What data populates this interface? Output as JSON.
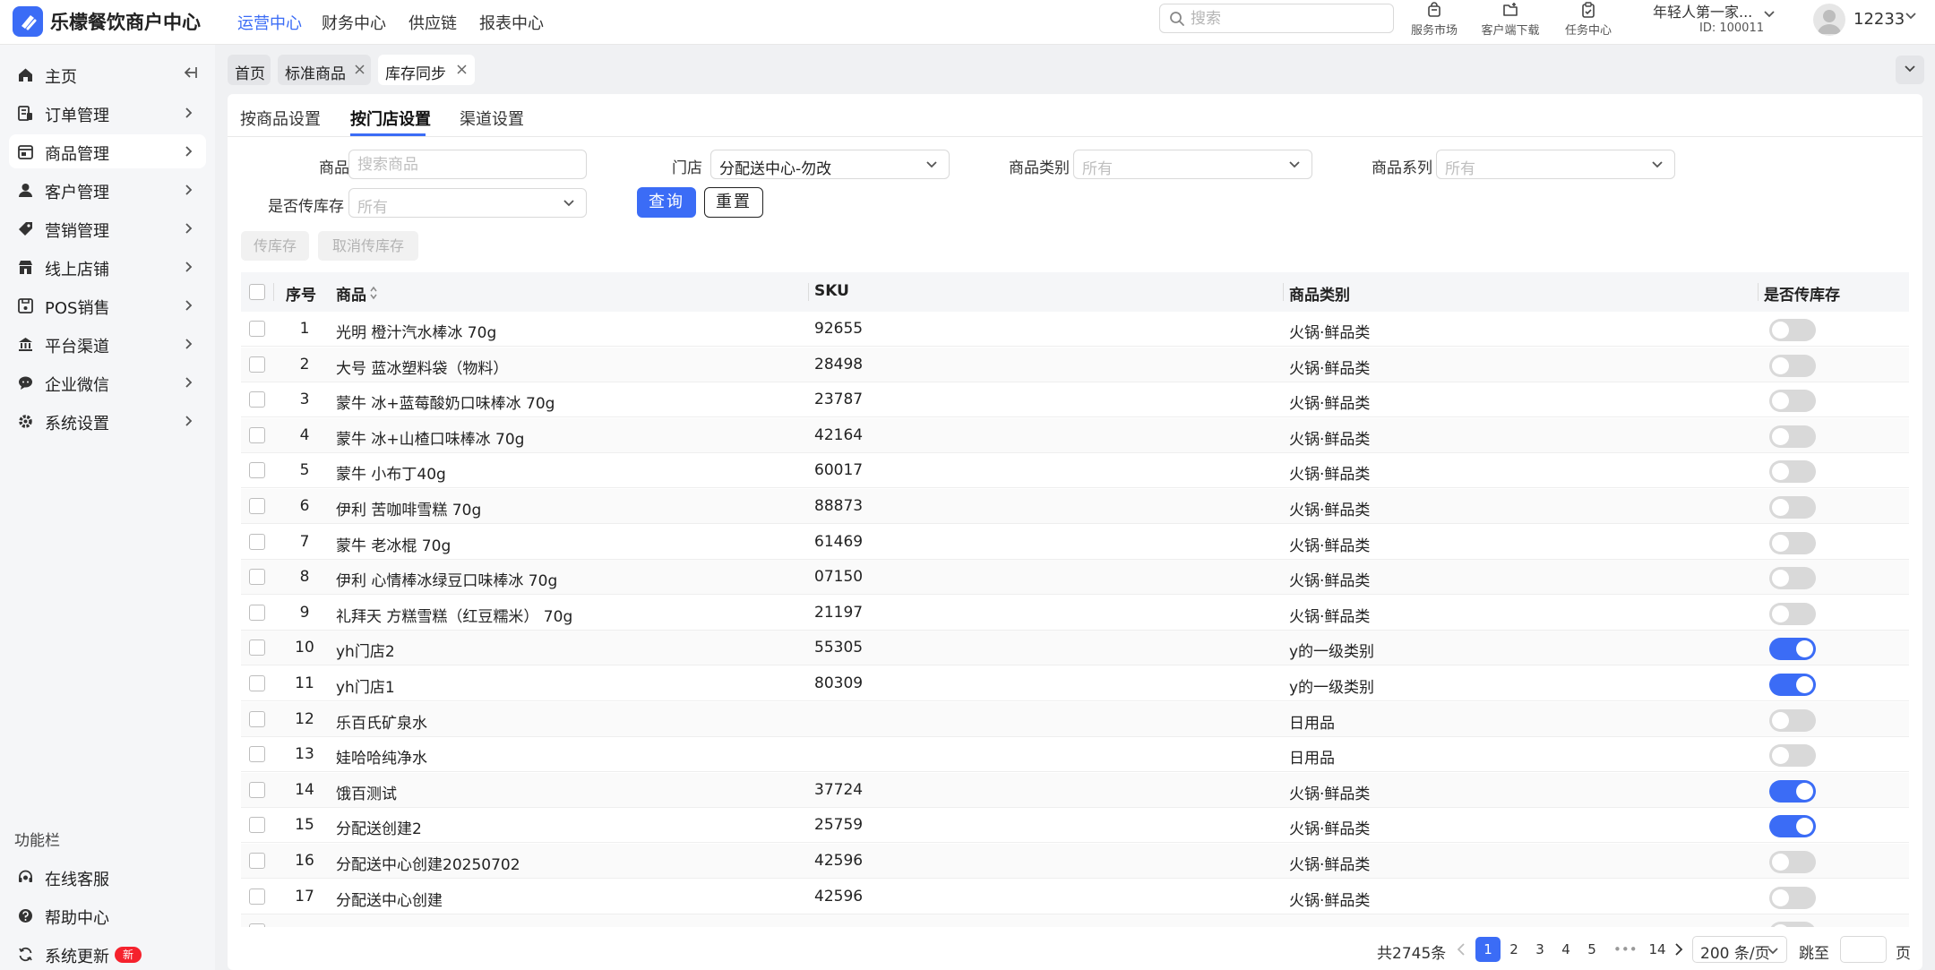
{
  "app": {
    "title": "乐檬餐饮商户中心"
  },
  "topnav": [
    "运营中心",
    "财务中心",
    "供应链",
    "报表中心"
  ],
  "search": {
    "placeholder": "搜索"
  },
  "tools": [
    "服务市场",
    "客户端下载",
    "任务中心"
  ],
  "account": {
    "name": "年轻人第一家...",
    "id": "ID: 100011",
    "user": "12233"
  },
  "sidebar": {
    "items": [
      "主页",
      "订单管理",
      "商品管理",
      "客户管理",
      "营销管理",
      "线上店铺",
      "POS销售",
      "平台渠道",
      "企业微信",
      "系统设置"
    ],
    "footer_title": "功能栏",
    "footer": [
      "在线客服",
      "帮助中心",
      "系统更新"
    ],
    "new_badge": "新"
  },
  "page_tabs": [
    "首页",
    "标准商品",
    "库存同步"
  ],
  "subtabs": [
    "按商品设置",
    "按门店设置",
    "渠道设置"
  ],
  "filters": {
    "product_label": "商品",
    "product_placeholder": "搜索商品",
    "store_label": "门店",
    "store_value": "分配送中心-勿改",
    "category_label": "商品类别",
    "category_value": "所有",
    "series_label": "商品系列",
    "series_value": "所有",
    "sync_label": "是否传库存",
    "sync_value": "所有"
  },
  "buttons": {
    "query": "查询",
    "reset": "重置",
    "sync": "传库存",
    "cancel_sync": "取消传库存"
  },
  "table": {
    "headers": [
      "序号",
      "商品",
      "SKU",
      "商品类别",
      "是否传库存"
    ],
    "rows": [
      {
        "no": "1",
        "name": "光明 橙汁汽水棒冰 70g",
        "sku": "92655",
        "category": "火锅·鲜品类",
        "sync": false
      },
      {
        "no": "2",
        "name": "大号 蓝冰塑料袋（物料）",
        "sku": "28498",
        "category": "火锅·鲜品类",
        "sync": false
      },
      {
        "no": "3",
        "name": "蒙牛 冰+蓝莓酸奶口味棒冰 70g",
        "sku": "23787",
        "category": "火锅·鲜品类",
        "sync": false
      },
      {
        "no": "4",
        "name": "蒙牛 冰+山楂口味棒冰 70g",
        "sku": "42164",
        "category": "火锅·鲜品类",
        "sync": false
      },
      {
        "no": "5",
        "name": "蒙牛 小布丁40g",
        "sku": "60017",
        "category": "火锅·鲜品类",
        "sync": false
      },
      {
        "no": "6",
        "name": "伊利 苦咖啡雪糕 70g",
        "sku": "88873",
        "category": "火锅·鲜品类",
        "sync": false
      },
      {
        "no": "7",
        "name": "蒙牛 老冰棍 70g",
        "sku": "61469",
        "category": "火锅·鲜品类",
        "sync": false
      },
      {
        "no": "8",
        "name": "伊利 心情棒冰绿豆口味棒冰 70g",
        "sku": "07150",
        "category": "火锅·鲜品类",
        "sync": false
      },
      {
        "no": "9",
        "name": "礼拜天 方糕雪糕（红豆糯米） 70g",
        "sku": "21197",
        "category": "火锅·鲜品类",
        "sync": false
      },
      {
        "no": "10",
        "name": "yh门店2",
        "sku": "55305",
        "category": "y的一级类别",
        "sync": true
      },
      {
        "no": "11",
        "name": "yh门店1",
        "sku": "80309",
        "category": "y的一级类别",
        "sync": true
      },
      {
        "no": "12",
        "name": "乐百氏矿泉水",
        "sku": "",
        "category": "日用品",
        "sync": false
      },
      {
        "no": "13",
        "name": "娃哈哈纯净水",
        "sku": "",
        "category": "日用品",
        "sync": false
      },
      {
        "no": "14",
        "name": "饿百测试",
        "sku": "37724",
        "category": "火锅·鲜品类",
        "sync": true
      },
      {
        "no": "15",
        "name": "分配送创建2",
        "sku": "25759",
        "category": "火锅·鲜品类",
        "sync": true
      },
      {
        "no": "16",
        "name": "分配送中心创建20250702",
        "sku": "42596",
        "category": "火锅·鲜品类",
        "sync": false
      },
      {
        "no": "17",
        "name": "分配送中心创建",
        "sku": "42596",
        "category": "火锅·鲜品类",
        "sync": false
      }
    ]
  },
  "pagination": {
    "total": "共2745条",
    "pages": [
      "1",
      "2",
      "3",
      "4",
      "5",
      "14"
    ],
    "current": "1",
    "dots": "•••",
    "page_size": "200 条/页",
    "jump_label": "跳至",
    "jump_unit": "页"
  },
  "colors": {
    "accent": "#3b6cf6",
    "danger": "#f5222d"
  }
}
